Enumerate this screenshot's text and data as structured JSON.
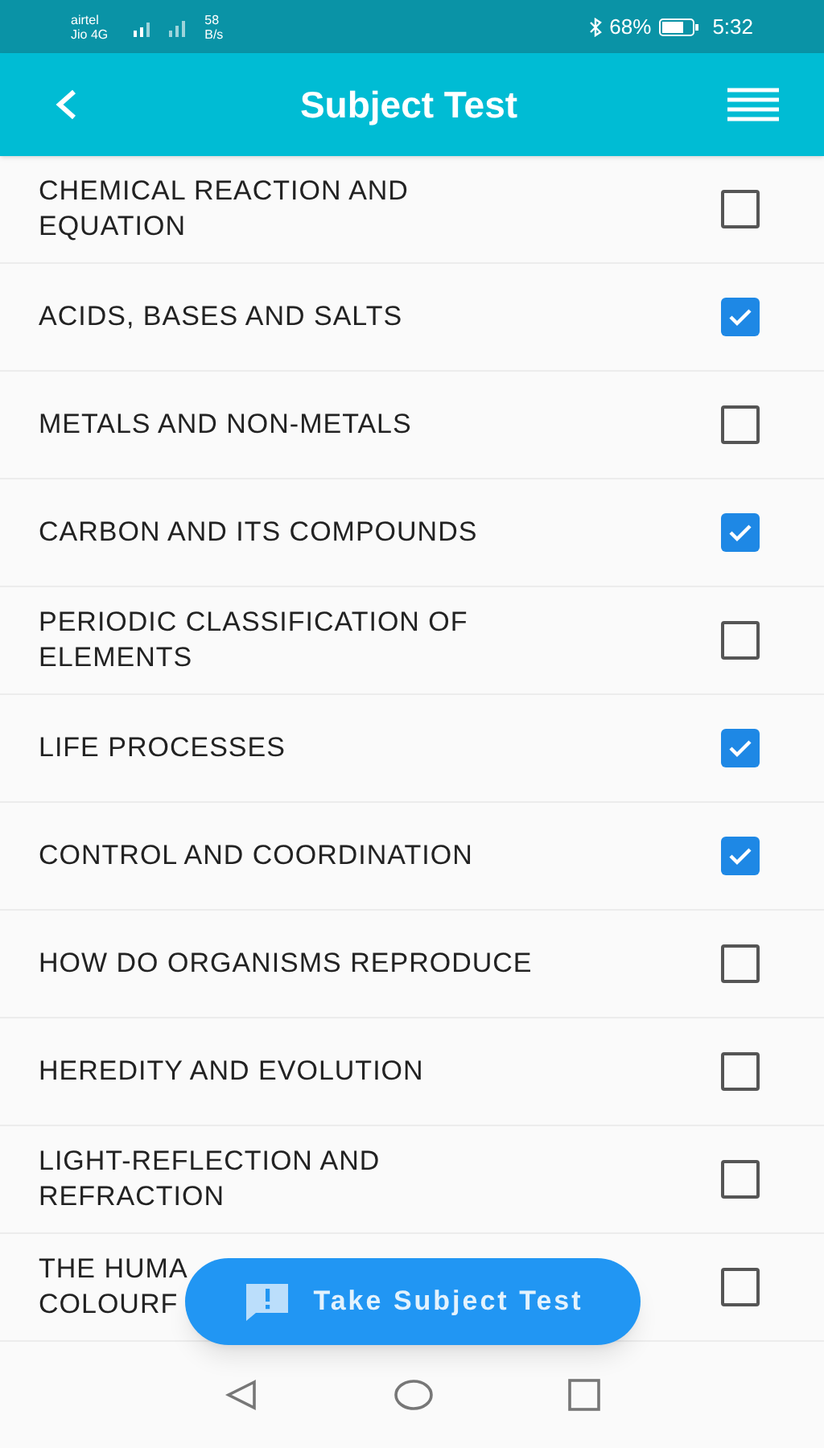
{
  "status_bar": {
    "carrier_1": "airtel",
    "carrier_2": "Jio 4G",
    "speed_value": "58",
    "speed_unit": "B/s",
    "battery": "68%",
    "time": "5:32"
  },
  "app_bar": {
    "title": "Subject Test"
  },
  "chapters": [
    {
      "lines": [
        "CHEMICAL REACTION AND",
        "EQUATION"
      ],
      "checked": false
    },
    {
      "lines": [
        "ACIDS, BASES AND SALTS"
      ],
      "checked": true
    },
    {
      "lines": [
        "METALS AND NON-METALS"
      ],
      "checked": false
    },
    {
      "lines": [
        "CARBON AND ITS COMPOUNDS"
      ],
      "checked": true
    },
    {
      "lines": [
        "PERIODIC CLASSIFICATION OF",
        "ELEMENTS"
      ],
      "checked": false
    },
    {
      "lines": [
        "LIFE PROCESSES"
      ],
      "checked": true
    },
    {
      "lines": [
        "CONTROL AND COORDINATION"
      ],
      "checked": true
    },
    {
      "lines": [
        "HOW DO ORGANISMS REPRODUCE"
      ],
      "checked": false
    },
    {
      "lines": [
        "HEREDITY AND EVOLUTION"
      ],
      "checked": false
    },
    {
      "lines": [
        "LIGHT-REFLECTION AND",
        "REFRACTION"
      ],
      "checked": false
    },
    {
      "lines": [
        "THE HUMA",
        "COLOURF"
      ],
      "checked": false
    }
  ],
  "fab": {
    "label": "Take Subject Test"
  }
}
